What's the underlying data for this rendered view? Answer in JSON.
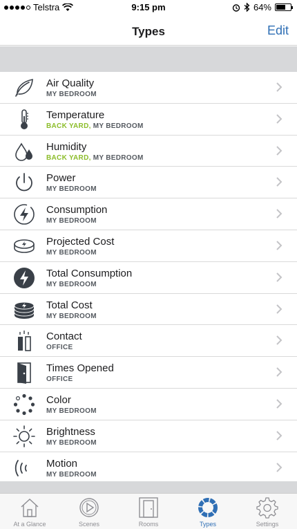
{
  "status": {
    "carrier": "Telstra",
    "time": "9:15 pm",
    "battery": "64%",
    "battery_level": 0.64
  },
  "nav": {
    "title": "Types",
    "edit_label": "Edit"
  },
  "types": [
    {
      "title": "Air Quality",
      "sub_green": "",
      "sub_rest": "MY BEDROOM",
      "icon": "leaf-icon"
    },
    {
      "title": "Temperature",
      "sub_green": "BACK YARD,",
      "sub_rest": " MY BEDROOM",
      "icon": "thermometer-icon"
    },
    {
      "title": "Humidity",
      "sub_green": "BACK YARD,",
      "sub_rest": " MY BEDROOM",
      "icon": "water-drops-icon"
    },
    {
      "title": "Power",
      "sub_green": "",
      "sub_rest": "MY BEDROOM",
      "icon": "power-icon"
    },
    {
      "title": "Consumption",
      "sub_green": "",
      "sub_rest": "MY BEDROOM",
      "icon": "lightning-circle-icon"
    },
    {
      "title": "Projected Cost",
      "sub_green": "",
      "sub_rest": "MY BEDROOM",
      "icon": "coin-stack-outline-icon"
    },
    {
      "title": "Total Consumption",
      "sub_green": "",
      "sub_rest": "MY BEDROOM",
      "icon": "lightning-filled-icon"
    },
    {
      "title": "Total Cost",
      "sub_green": "",
      "sub_rest": "MY BEDROOM",
      "icon": "coin-stack-filled-icon"
    },
    {
      "title": "Contact",
      "sub_green": "",
      "sub_rest": "OFFICE",
      "icon": "contact-sensor-icon"
    },
    {
      "title": "Times Opened",
      "sub_green": "",
      "sub_rest": "OFFICE",
      "icon": "door-open-icon"
    },
    {
      "title": "Color",
      "sub_green": "",
      "sub_rest": "MY BEDROOM",
      "icon": "color-ring-icon"
    },
    {
      "title": "Brightness",
      "sub_green": "",
      "sub_rest": "MY BEDROOM",
      "icon": "sun-icon"
    },
    {
      "title": "Motion",
      "sub_green": "",
      "sub_rest": "MY BEDROOM",
      "icon": "motion-waves-icon"
    }
  ],
  "tabs": [
    {
      "label": "At a Glance",
      "icon": "house-icon"
    },
    {
      "label": "Scenes",
      "icon": "play-circle-icon"
    },
    {
      "label": "Rooms",
      "icon": "door-icon"
    },
    {
      "label": "Types",
      "icon": "types-ring-icon",
      "active": true
    },
    {
      "label": "Settings",
      "icon": "gear-icon"
    }
  ],
  "colors": {
    "accent": "#2f6fb5",
    "highlight_green": "#8cbd2a",
    "icon_dark": "#3a4048"
  }
}
